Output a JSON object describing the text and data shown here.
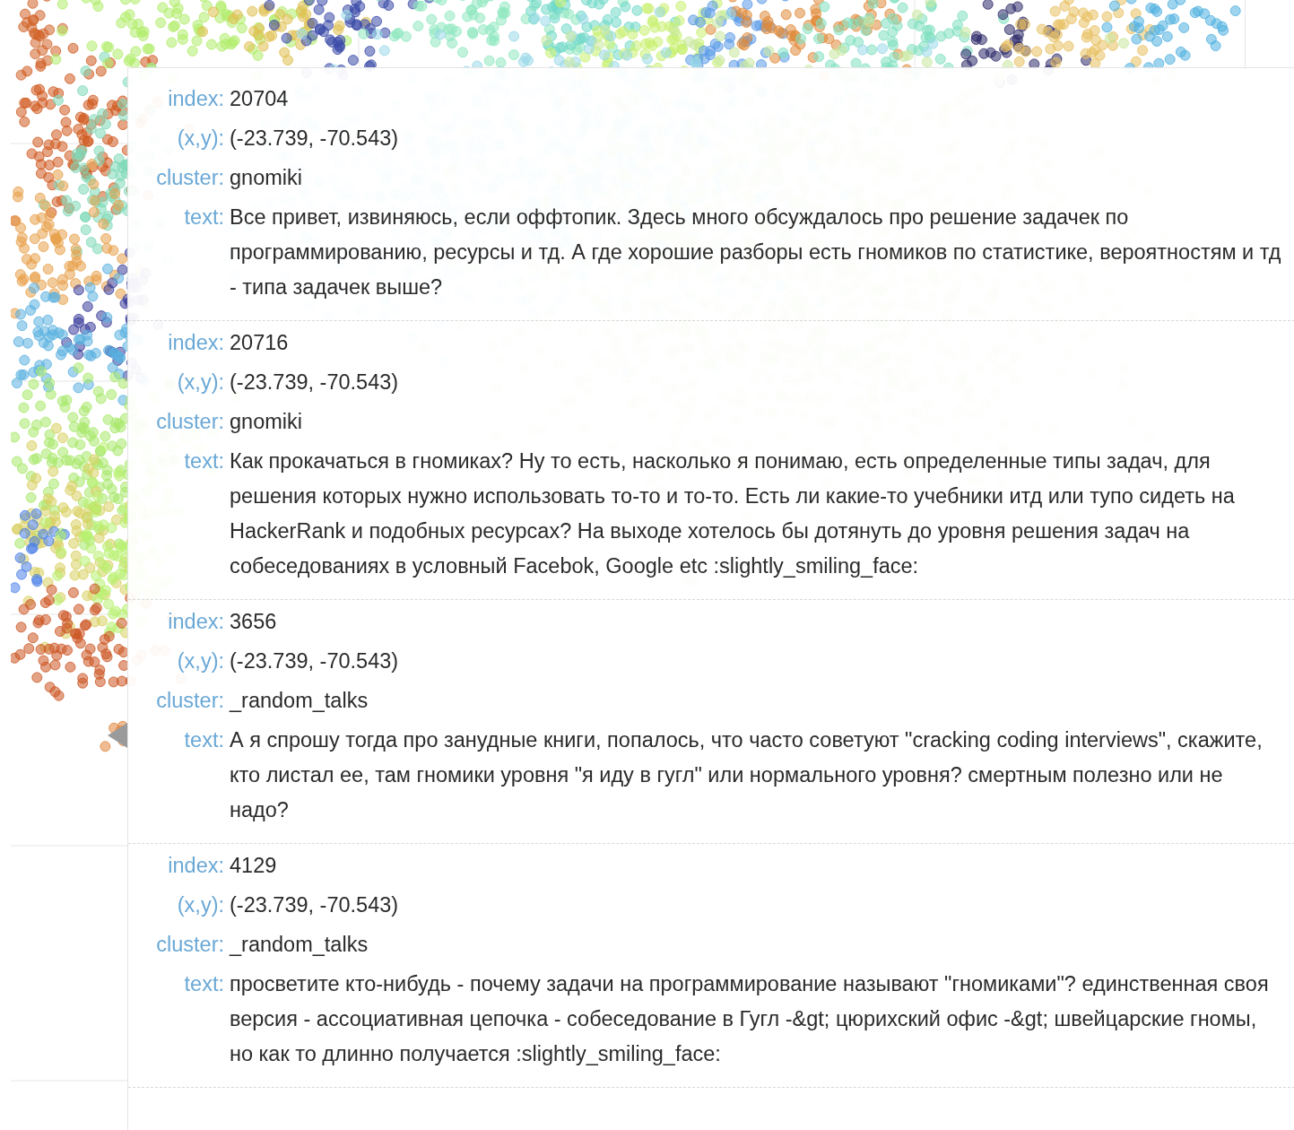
{
  "tooltip": {
    "entries": [
      {
        "fields": [
          {
            "label": "index:",
            "value": "20704"
          },
          {
            "label": "(x,y):",
            "value": "(-23.739, -70.543)"
          },
          {
            "label": "cluster:",
            "value": "gnomiki"
          },
          {
            "label": "text:",
            "value": "Все привет, извиняюсь, если оффтопик. Здесь много обсуждалось про решение задачек по программированию, ресурсы и тд. А где хорошие разборы есть гномиков по статистике, вероятностям и тд - типа задачек выше?"
          }
        ]
      },
      {
        "fields": [
          {
            "label": "index:",
            "value": "20716"
          },
          {
            "label": "(x,y):",
            "value": "(-23.739, -70.543)"
          },
          {
            "label": "cluster:",
            "value": "gnomiki"
          },
          {
            "label": "text:",
            "value": "Как прокачаться в гномиках? Ну то есть, насколько я понимаю, есть определенные типы задач, для решения которых нужно использовать то-то и то-то. Есть ли какие-то учебники итд или тупо сидеть на HackerRank и подобных ресурсах? На выходе хотелось бы дотянуть до уровня решения задач на собеседованиях в условный Facebok, Google etc :slightly_smiling_face:"
          }
        ]
      },
      {
        "fields": [
          {
            "label": "index:",
            "value": "3656"
          },
          {
            "label": "(x,y):",
            "value": "(-23.739, -70.543)"
          },
          {
            "label": "cluster:",
            "value": "_random_talks"
          },
          {
            "label": "text:",
            "value": "А я спрошу тогда про занудные книги, попалось, что часто советуют \"cracking coding interviews\", скажите, кто листал ее, там гномики уровня \"я иду в гугл\" или нормального уровня? смертным полезно или не надо?"
          }
        ]
      },
      {
        "fields": [
          {
            "label": "index:",
            "value": "4129"
          },
          {
            "label": "(x,y):",
            "value": "(-23.739, -70.543)"
          },
          {
            "label": "cluster:",
            "value": "_random_talks"
          },
          {
            "label": "text:",
            "value": "просветите кто-нибудь - почему задачи на программирование называют \"гномиками\"? единственная своя версия - ассоциативная цепочка - собеседование в Гугл -&gt; цюрихский офис -&gt; швейцарские гномы, но как то длинно получается :slightly_smiling_face:"
          }
        ]
      }
    ]
  }
}
